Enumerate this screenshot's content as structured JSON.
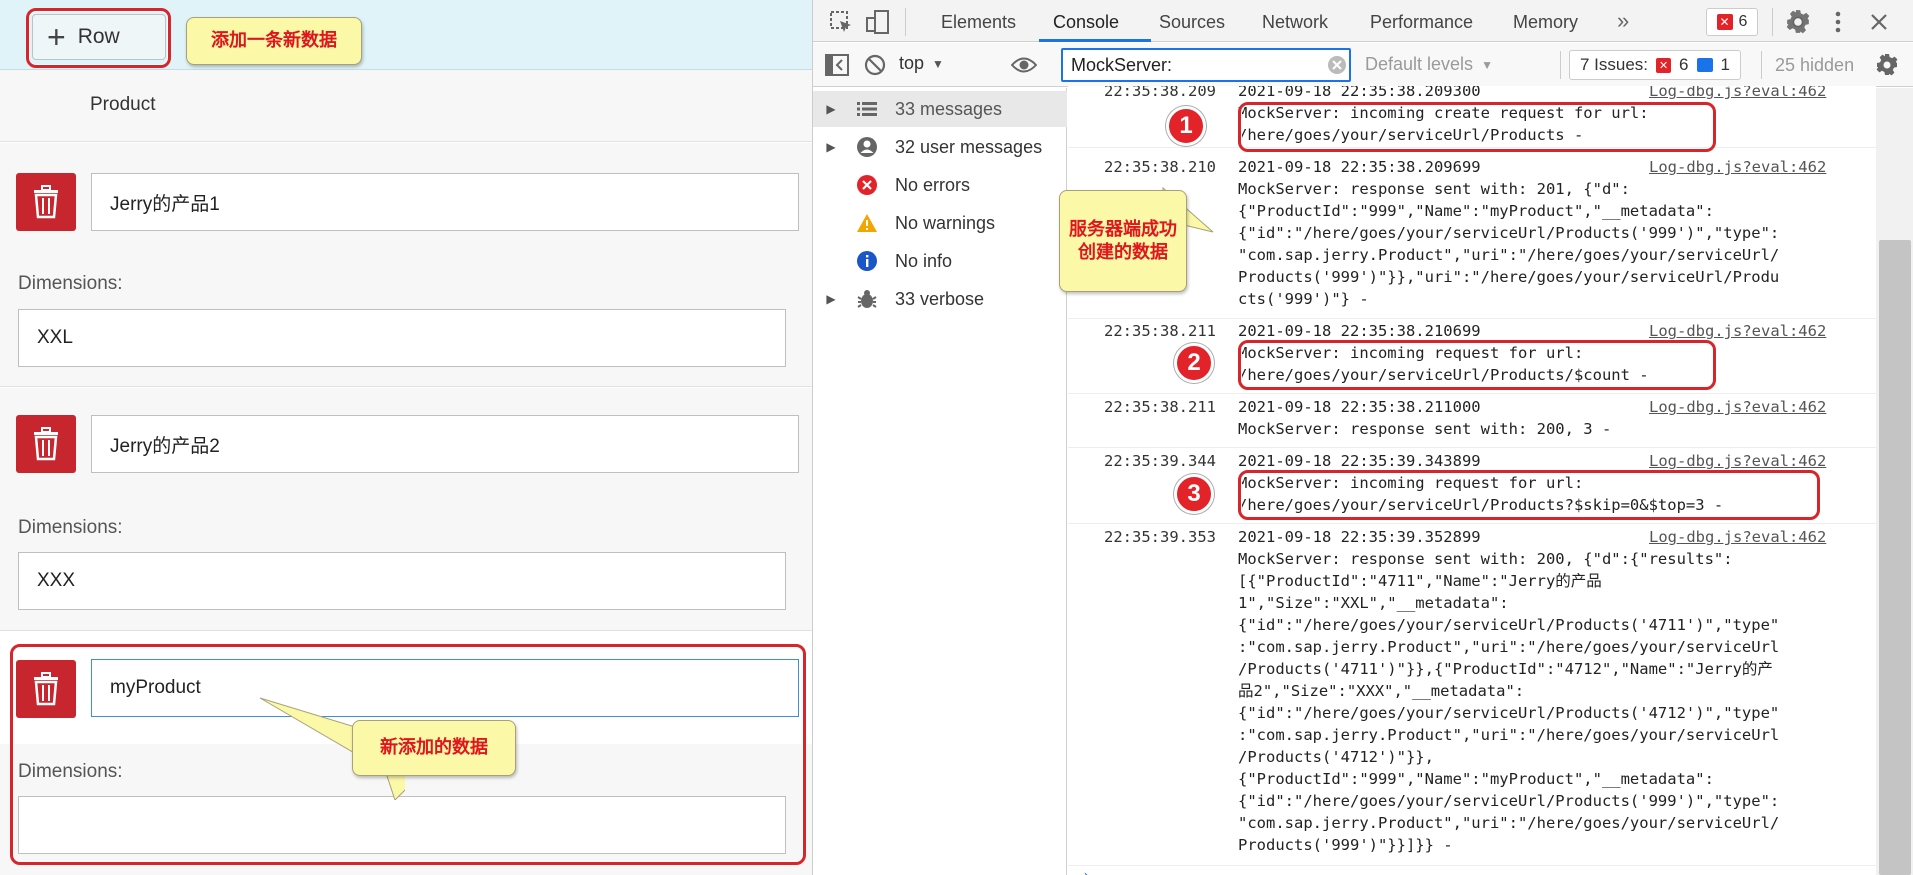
{
  "left": {
    "toolbar": {
      "add_row_label": "Row",
      "callout_add": "添加一条新数据"
    },
    "header": {
      "column_title": "Product"
    },
    "items": [
      {
        "product": "Jerry的产品1",
        "dimension_label": "Dimensions:",
        "dimension": "XXL"
      },
      {
        "product": "Jerry的产品2",
        "dimension_label": "Dimensions:",
        "dimension": "XXX"
      },
      {
        "product": "myProduct",
        "dimension_label": "Dimensions:",
        "dimension": ""
      }
    ],
    "callout_new": "新添加的数据"
  },
  "devtools": {
    "tabs": [
      "Elements",
      "Console",
      "Sources",
      "Network",
      "Performance",
      "Memory"
    ],
    "active_tab": "Console",
    "more_tabs": "»",
    "error_badge_count": "6",
    "filter": {
      "context": "top",
      "filter_value": "MockServer:",
      "levels": "Default levels",
      "issues_label": "7 Issues:",
      "issues_errors": "6",
      "issues_info": "1",
      "hidden": "25 hidden"
    },
    "sidebar": [
      {
        "label": "33 messages",
        "icon": "list-icon"
      },
      {
        "label": "32 user messages",
        "icon": "user-icon"
      },
      {
        "label": "No errors",
        "icon": "error-icon"
      },
      {
        "label": "No warnings",
        "icon": "warning-icon"
      },
      {
        "label": "No info",
        "icon": "info-icon"
      },
      {
        "label": "33 verbose",
        "icon": "bug-icon"
      }
    ],
    "logs": [
      {
        "time": "22:35:38.209",
        "lines": [
          "2021-09-18 22:35:38.209300",
          "MockServer: incoming create request for url:",
          "/here/goes/your/serviceUrl/Products -"
        ],
        "source": "Log-dbg.js?eval:462"
      },
      {
        "time": "22:35:38.210",
        "lines": [
          "2021-09-18 22:35:38.209699",
          "MockServer: response sent with: 201, {\"d\":",
          "{\"ProductId\":\"999\",\"Name\":\"myProduct\",\"__metadata\":",
          "{\"id\":\"/here/goes/your/serviceUrl/Products('999')\",\"type\":",
          "\"com.sap.jerry.Product\",\"uri\":\"/here/goes/your/serviceUrl/",
          "Products('999')\"}},\"uri\":\"/here/goes/your/serviceUrl/Produ",
          "cts('999')\"} -"
        ],
        "source": "Log-dbg.js?eval:462"
      },
      {
        "time": "22:35:38.211",
        "lines": [
          "2021-09-18 22:35:38.210699",
          "MockServer: incoming request for url:",
          "/here/goes/your/serviceUrl/Products/$count -"
        ],
        "source": "Log-dbg.js?eval:462"
      },
      {
        "time": "22:35:38.211",
        "lines": [
          "2021-09-18 22:35:38.211000",
          "MockServer: response sent with: 200, 3 -"
        ],
        "source": "Log-dbg.js?eval:462"
      },
      {
        "time": "22:35:39.344",
        "lines": [
          "2021-09-18 22:35:39.343899",
          "MockServer: incoming request for url:",
          "/here/goes/your/serviceUrl/Products?$skip=0&$top=3 -"
        ],
        "source": "Log-dbg.js?eval:462"
      },
      {
        "time": "22:35:39.353",
        "lines": [
          "2021-09-18 22:35:39.352899",
          "MockServer: response sent with: 200, {\"d\":{\"results\":",
          "[{\"ProductId\":\"4711\",\"Name\":\"Jerry的产品",
          "1\",\"Size\":\"XXL\",\"__metadata\":",
          "{\"id\":\"/here/goes/your/serviceUrl/Products('4711')\",\"type\"",
          ":\"com.sap.jerry.Product\",\"uri\":\"/here/goes/your/serviceUrl",
          "/Products('4711')\"}},{\"ProductId\":\"4712\",\"Name\":\"Jerry的产",
          "品2\",\"Size\":\"XXX\",\"__metadata\":",
          "{\"id\":\"/here/goes/your/serviceUrl/Products('4712')\",\"type\"",
          ":\"com.sap.jerry.Product\",\"uri\":\"/here/goes/your/serviceUrl",
          "/Products('4712')\"}},",
          "{\"ProductId\":\"999\",\"Name\":\"myProduct\",\"__metadata\":",
          "{\"id\":\"/here/goes/your/serviceUrl/Products('999')\",\"type\":",
          "\"com.sap.jerry.Product\",\"uri\":\"/here/goes/your/serviceUrl/",
          "Products('999')\"}}]}} -"
        ],
        "source": "Log-dbg.js?eval:462"
      }
    ],
    "annotations": {
      "step1": "1",
      "step2": "2",
      "step3": "3",
      "callout_server": "服务器端成功创建的数据"
    },
    "colors": {
      "accent_red": "#d6262b",
      "callout_bg": "#fbf8a8",
      "tab_underline": "#1a73e8"
    }
  }
}
